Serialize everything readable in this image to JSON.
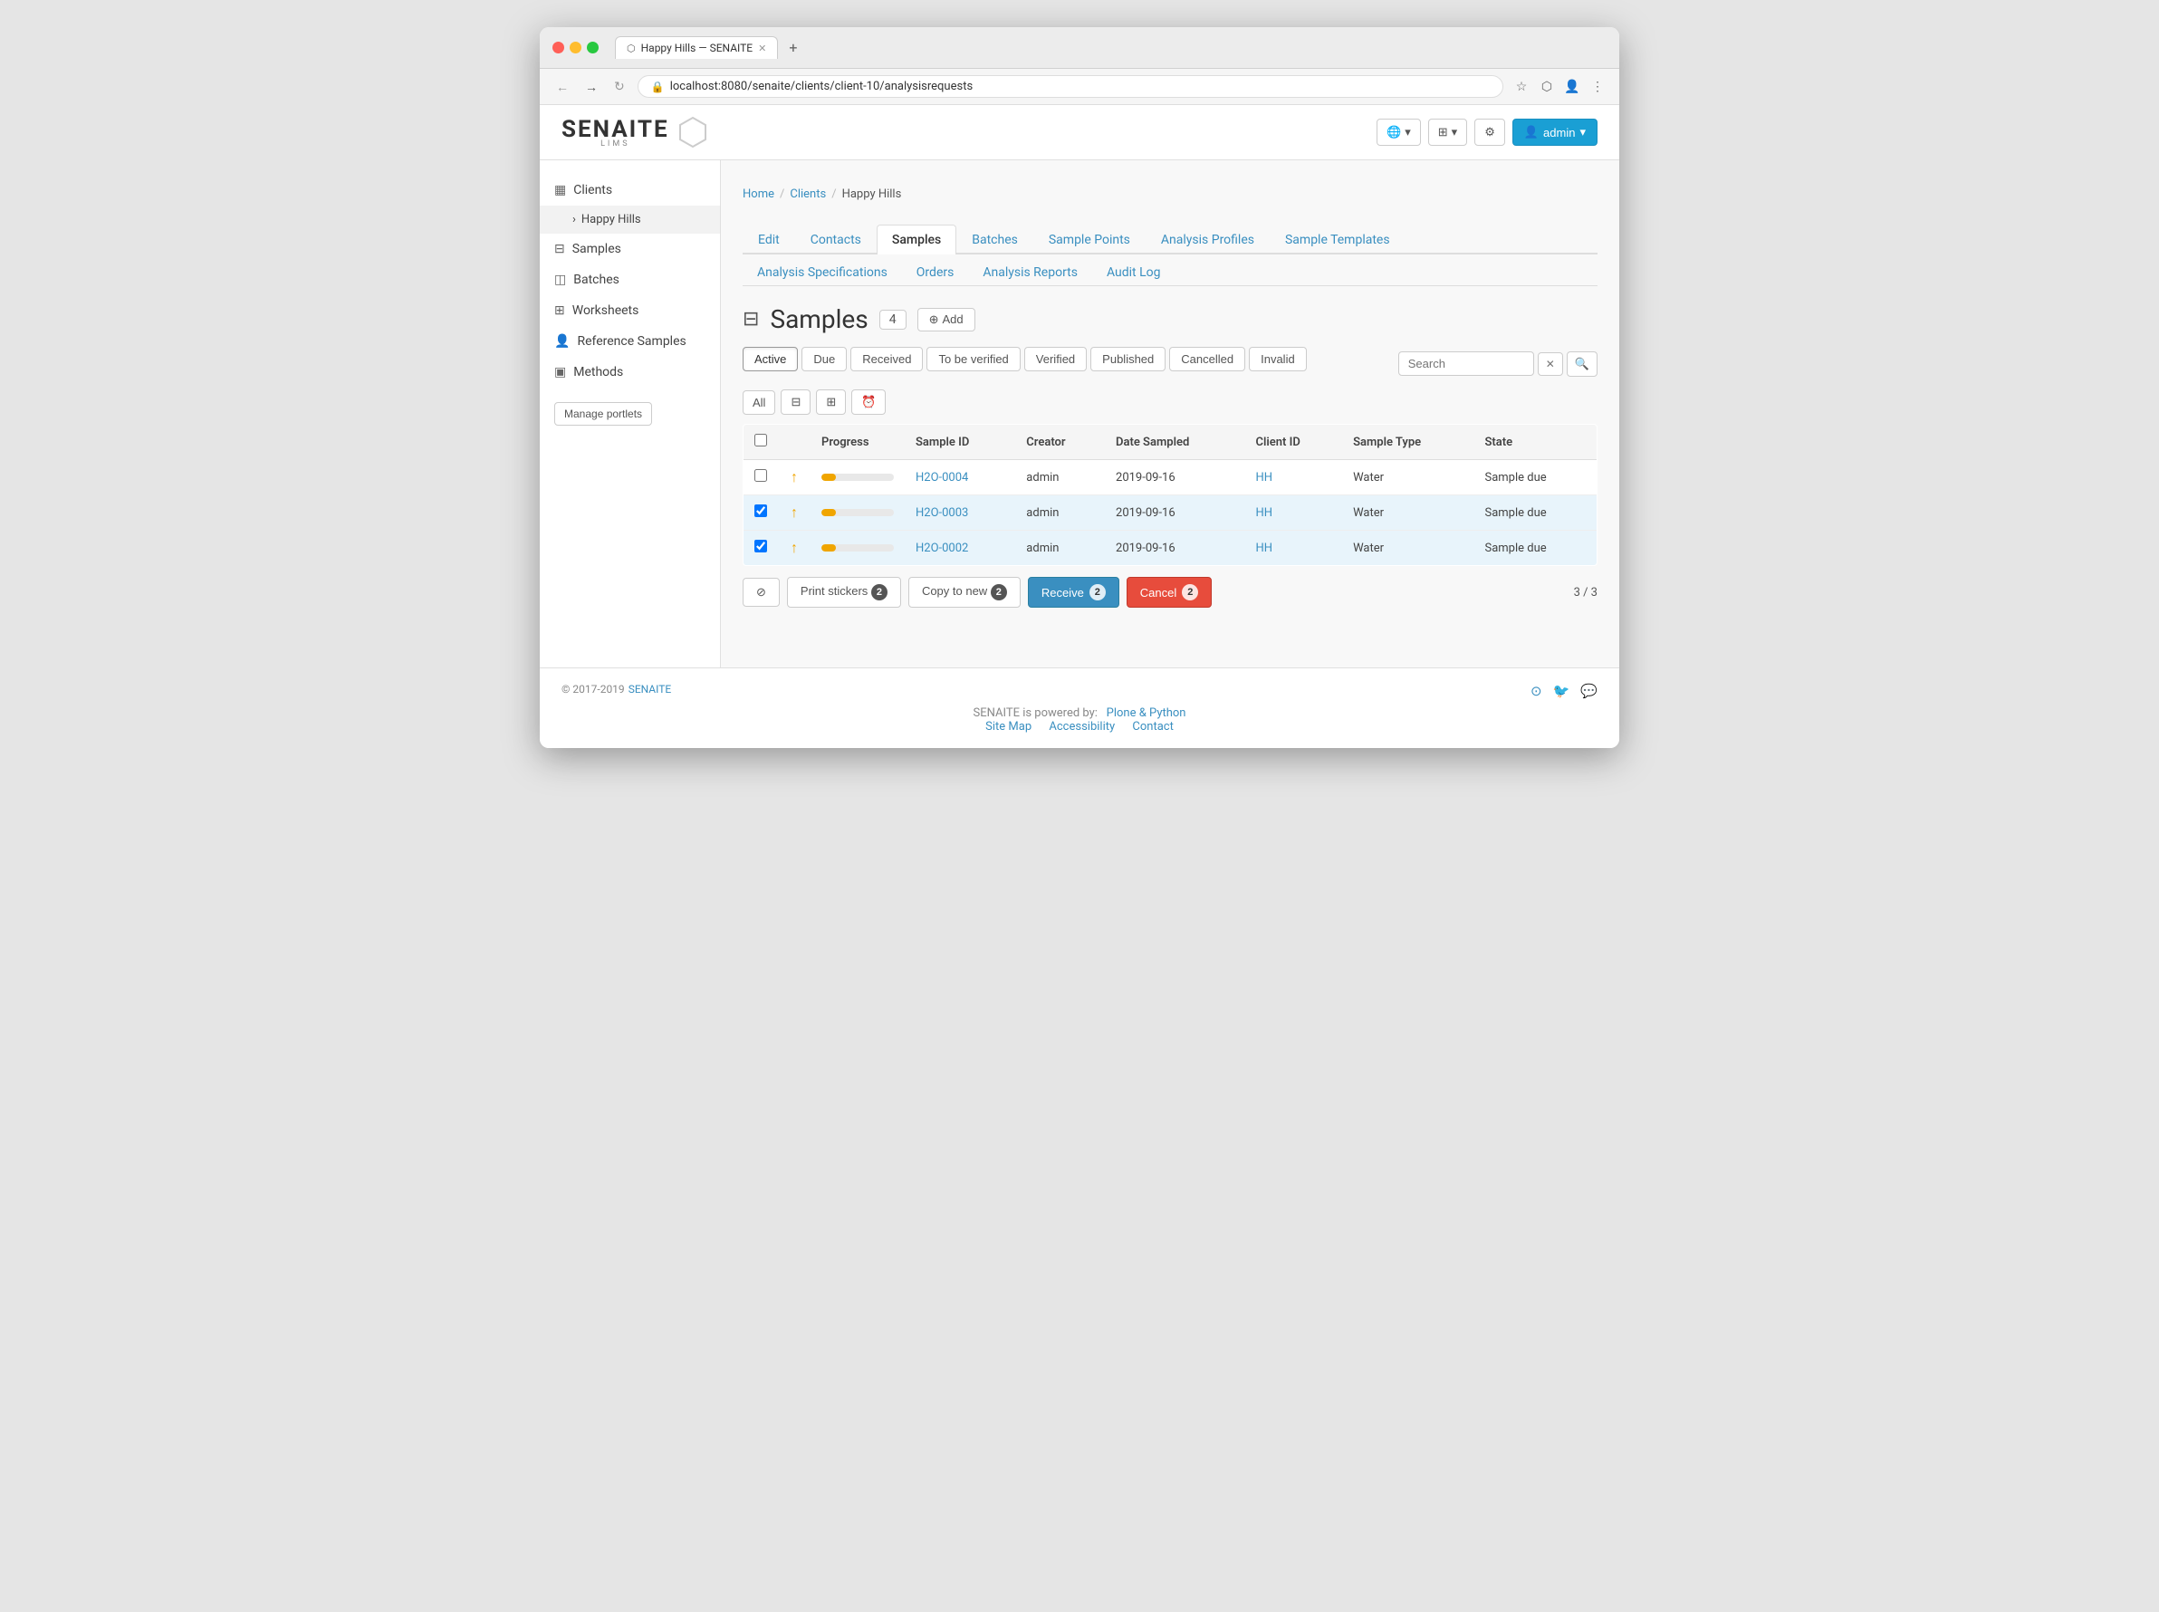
{
  "browser": {
    "tab_title": "Happy Hills — SENAITE",
    "url": "localhost:8080/senaite/clients/client-10/analysisrequests"
  },
  "header": {
    "logo_text": "SENAITE",
    "logo_sub": "LIMS",
    "globe_btn": "🌐",
    "grid_btn": "⊞",
    "gear_btn": "⚙",
    "admin_label": "admin"
  },
  "sidebar": {
    "items": [
      {
        "id": "clients",
        "label": "Clients",
        "icon": "▦"
      },
      {
        "id": "happy-hills",
        "label": "Happy Hills",
        "icon": "›",
        "child": true
      },
      {
        "id": "samples",
        "label": "Samples",
        "icon": "⊟"
      },
      {
        "id": "batches",
        "label": "Batches",
        "icon": "◫"
      },
      {
        "id": "worksheets",
        "label": "Worksheets",
        "icon": "⊞"
      },
      {
        "id": "reference-samples",
        "label": "Reference Samples",
        "icon": "👤"
      },
      {
        "id": "methods",
        "label": "Methods",
        "icon": "▣"
      }
    ],
    "manage_portlets": "Manage portlets"
  },
  "breadcrumb": {
    "items": [
      "Home",
      "Clients",
      "Happy Hills"
    ]
  },
  "tabs_primary": [
    {
      "id": "edit",
      "label": "Edit",
      "active": false
    },
    {
      "id": "contacts",
      "label": "Contacts",
      "active": false
    },
    {
      "id": "samples",
      "label": "Samples",
      "active": true
    },
    {
      "id": "batches",
      "label": "Batches",
      "active": false
    },
    {
      "id": "sample-points",
      "label": "Sample Points",
      "active": false
    },
    {
      "id": "analysis-profiles",
      "label": "Analysis Profiles",
      "active": false
    },
    {
      "id": "sample-templates",
      "label": "Sample Templates",
      "active": false
    }
  ],
  "tabs_secondary": [
    {
      "id": "analysis-specifications",
      "label": "Analysis Specifications"
    },
    {
      "id": "orders",
      "label": "Orders"
    },
    {
      "id": "analysis-reports",
      "label": "Analysis Reports"
    },
    {
      "id": "audit-log",
      "label": "Audit Log"
    }
  ],
  "page": {
    "title": "Samples",
    "count": "4",
    "add_label": "Add"
  },
  "status_filters": [
    {
      "id": "active",
      "label": "Active",
      "active": true
    },
    {
      "id": "due",
      "label": "Due",
      "active": false
    },
    {
      "id": "received",
      "label": "Received",
      "active": false
    },
    {
      "id": "to-be-verified",
      "label": "To be verified",
      "active": false
    },
    {
      "id": "verified",
      "label": "Verified",
      "active": false
    },
    {
      "id": "published",
      "label": "Published",
      "active": false
    },
    {
      "id": "cancelled",
      "label": "Cancelled",
      "active": false
    },
    {
      "id": "invalid",
      "label": "Invalid",
      "active": false
    }
  ],
  "search": {
    "placeholder": "Search",
    "clear_label": "×",
    "go_label": "🔍"
  },
  "table": {
    "columns": [
      "",
      "",
      "Progress",
      "Sample ID",
      "Creator",
      "Date Sampled",
      "Client ID",
      "Sample Type",
      "State"
    ],
    "rows": [
      {
        "id": "H2O-0004",
        "selected": false,
        "progress": 20,
        "creator": "admin",
        "date_sampled": "2019-09-16",
        "client_id": "HH",
        "sample_type": "Water",
        "state": "Sample due"
      },
      {
        "id": "H2O-0003",
        "selected": true,
        "progress": 20,
        "creator": "admin",
        "date_sampled": "2019-09-16",
        "client_id": "HH",
        "sample_type": "Water",
        "state": "Sample due"
      },
      {
        "id": "H2O-0002",
        "selected": true,
        "progress": 20,
        "creator": "admin",
        "date_sampled": "2019-09-16",
        "client_id": "HH",
        "sample_type": "Water",
        "state": "Sample due"
      }
    ]
  },
  "bottom_actions": {
    "clear_label": "⊘",
    "print_stickers_label": "Print stickers",
    "print_stickers_count": "2",
    "copy_to_new_label": "Copy to new",
    "copy_to_new_count": "2",
    "receive_label": "Receive",
    "receive_count": "2",
    "cancel_label": "Cancel",
    "cancel_count": "2",
    "page_count": "3 / 3"
  },
  "footer": {
    "copyright": "© 2017-2019",
    "brand_name": "SENAITE",
    "powered_by": "SENAITE is powered by:",
    "powered_link": "Plone & Python",
    "links": [
      "Site Map",
      "Accessibility",
      "Contact"
    ]
  }
}
